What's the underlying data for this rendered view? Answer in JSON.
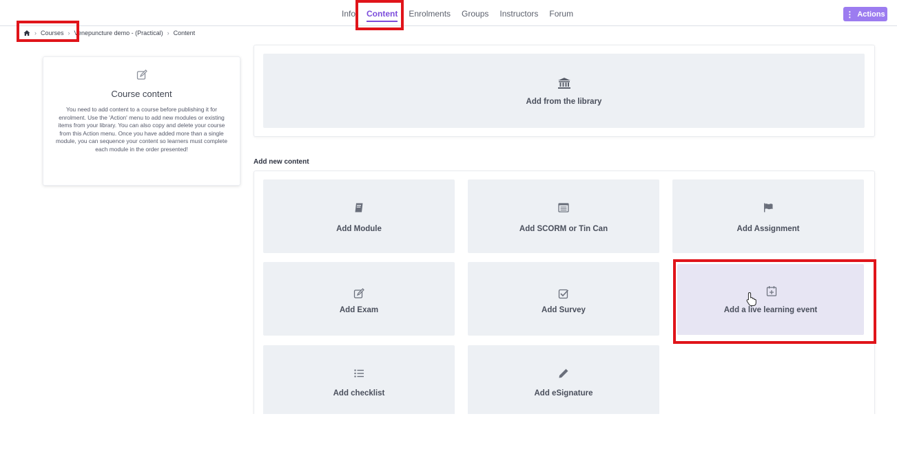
{
  "nav": {
    "tabs": [
      {
        "label": "Info",
        "active": false
      },
      {
        "label": "Content",
        "active": true
      },
      {
        "label": "Enrolments",
        "active": false
      },
      {
        "label": "Groups",
        "active": false
      },
      {
        "label": "Instructors",
        "active": false
      },
      {
        "label": "Forum",
        "active": false
      }
    ],
    "actions_label": "Actions",
    "accent_color": "#7c4ddb"
  },
  "breadcrumb": {
    "home_icon": "home-icon",
    "items": [
      "Courses",
      "Venepuncture demo - (Practical)",
      "Content"
    ]
  },
  "info_panel": {
    "icon": "edit-icon",
    "title": "Course content",
    "body": "You need to add content to a course before publishing it for enrolment. Use the 'Action' menu to add new modules or existing items from your library. You can also copy and delete your course from this Action menu. Once you have added more than a single module, you can sequence your content so learners must complete each module in the order presented!"
  },
  "library": {
    "icon": "library-icon",
    "label": "Add from the library"
  },
  "add_new": {
    "title": "Add new content",
    "tiles": [
      {
        "label": "Add Module",
        "icon": "book-icon"
      },
      {
        "label": "Add SCORM or Tin Can",
        "icon": "scorm-icon"
      },
      {
        "label": "Add Assignment",
        "icon": "flag-icon"
      },
      {
        "label": "Add Exam",
        "icon": "edit-icon"
      },
      {
        "label": "Add Survey",
        "icon": "checkbox-icon"
      },
      {
        "label": "Add a live learning event",
        "icon": "calendar-plus-icon",
        "hovered": true
      },
      {
        "label": "Add checklist",
        "icon": "list-icon"
      },
      {
        "label": "Add eSignature",
        "icon": "pencil-icon"
      }
    ]
  },
  "annotation_color": "#e0141a"
}
